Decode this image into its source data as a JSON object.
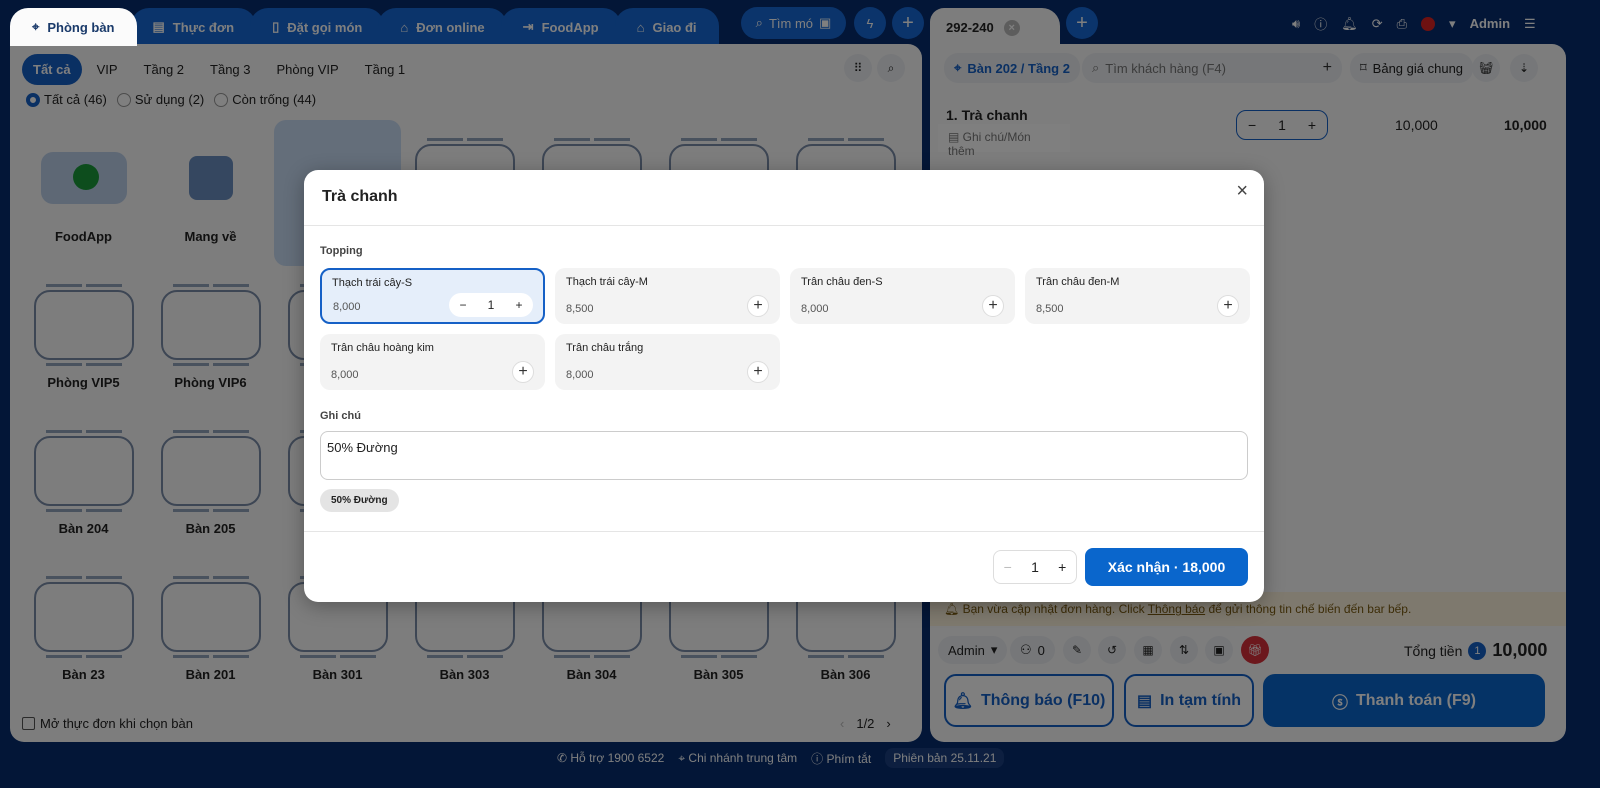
{
  "top_tabs": [
    {
      "label": "Phòng bàn",
      "icon": "table-icon",
      "active": true
    },
    {
      "label": "Thực đơn",
      "icon": "menu-icon"
    },
    {
      "label": "Đặt gọi món",
      "icon": "phone-order-icon"
    },
    {
      "label": "Đơn online",
      "icon": "bag-icon"
    },
    {
      "label": "FoodApp",
      "icon": "login-icon"
    },
    {
      "label": "Giao đi",
      "icon": "bag-icon"
    }
  ],
  "search_label": "Tìm mó",
  "filter_chips": [
    "Tất cả",
    "VIP",
    "Tầng 2",
    "Tầng 3",
    "Phòng VIP",
    "Tầng 1"
  ],
  "status_filters": [
    "Tất cả (46)",
    "Sử dụng (2)",
    "Còn trống (44)"
  ],
  "tables": {
    "row1": [
      "FoodApp",
      "Mang về"
    ],
    "row2": [
      "Phòng VIP5",
      "Phòng VIP6"
    ],
    "row3": [
      "Bàn 204",
      "Bàn 205"
    ],
    "row4": [
      "Bàn 23",
      "Bàn 201",
      "Bàn 301",
      "Bàn 303",
      "Bàn 304",
      "Bàn 305",
      "Bàn 306"
    ]
  },
  "open_menu_checkbox": "Mở thực đơn khi chọn bàn",
  "pagination": "1/2",
  "footer": {
    "support": "Hỗ trợ 1900 6522",
    "branch": "Chi nhánh trung tâm",
    "shortcuts": "Phím tắt",
    "version": "Phiên bản 25.11.21"
  },
  "order": {
    "tab": "292-240",
    "user": "Admin",
    "table": "Bàn 202 / Tầng 2",
    "customer_placeholder": "Tìm khách hàng (F4)",
    "price_list": "Bảng giá chung",
    "items": [
      {
        "name": "1. Trà chanh",
        "note": "Ghi chú/Món thêm",
        "qty": "1",
        "price": "10,000",
        "total": "10,000"
      }
    ],
    "notice": "Bạn vừa cập nhật đơn hàng. Click",
    "notice_link": "Thông báo",
    "notice_end": "để gửi thông tin chế biến đến bar bếp.",
    "staff": "Admin",
    "guests": "0",
    "total_label": "Tổng tiền",
    "total_count": "1",
    "total": "10,000",
    "notify_btn": "Thông báo (F10)",
    "print_btn": "In tạm tính",
    "pay_btn": "Thanh toán (F9)"
  },
  "modal": {
    "title": "Trà chanh",
    "topping_label": "Topping",
    "toppings": [
      {
        "name": "Thạch trái cây-S",
        "price": "8,000",
        "qty": "1",
        "selected": true
      },
      {
        "name": "Thạch trái cây-M",
        "price": "8,500"
      },
      {
        "name": "Trân châu đen-S",
        "price": "8,000"
      },
      {
        "name": "Trân châu đen-M",
        "price": "8,500"
      },
      {
        "name": "Trân châu hoàng kim",
        "price": "8,000"
      },
      {
        "name": "Trân châu trắng",
        "price": "8,000"
      }
    ],
    "note_label": "Ghi chú",
    "note_value": "50% Đường",
    "note_chip": "50% Đường",
    "qty": "1",
    "confirm": "Xác nhận · 18,000"
  }
}
